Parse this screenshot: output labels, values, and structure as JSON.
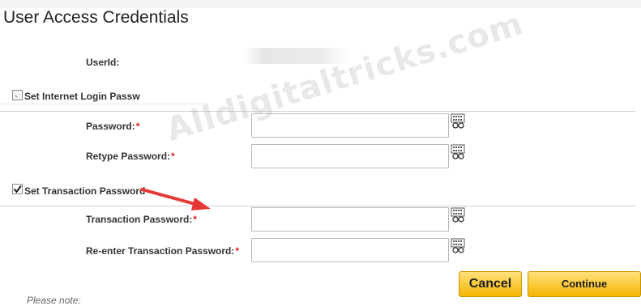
{
  "page": {
    "title": "User Access Credentials"
  },
  "userid": {
    "label": "UserId:"
  },
  "internet_section": {
    "checkbox_label": "Set Internet Login Password",
    "checked": false,
    "fields": [
      {
        "label": "Password:",
        "required_mark": "*",
        "value": ""
      },
      {
        "label": "Retype Password:",
        "required_mark": "*",
        "value": ""
      }
    ]
  },
  "transaction_section": {
    "checkbox_label": "Set Transaction Password",
    "checked": true,
    "fields": [
      {
        "label": "Transaction Password:",
        "required_mark": "*",
        "value": ""
      },
      {
        "label": "Re-enter Transaction Password:",
        "required_mark": "*",
        "value": ""
      }
    ]
  },
  "icons": {
    "keyboard": "virtual-keyboard-icon",
    "checkmark": "checkmark-icon",
    "arrow": "red-arrow-annotation"
  },
  "watermark": "Alldigitaltricks.com",
  "buttons": {
    "cancel": "Cancel",
    "continue": "Continue"
  },
  "note": "Please note:",
  "colors": {
    "required": "#d9261c",
    "button_top": "#ffe17a",
    "button_bottom": "#f5b400",
    "arrow": "#e53935"
  }
}
